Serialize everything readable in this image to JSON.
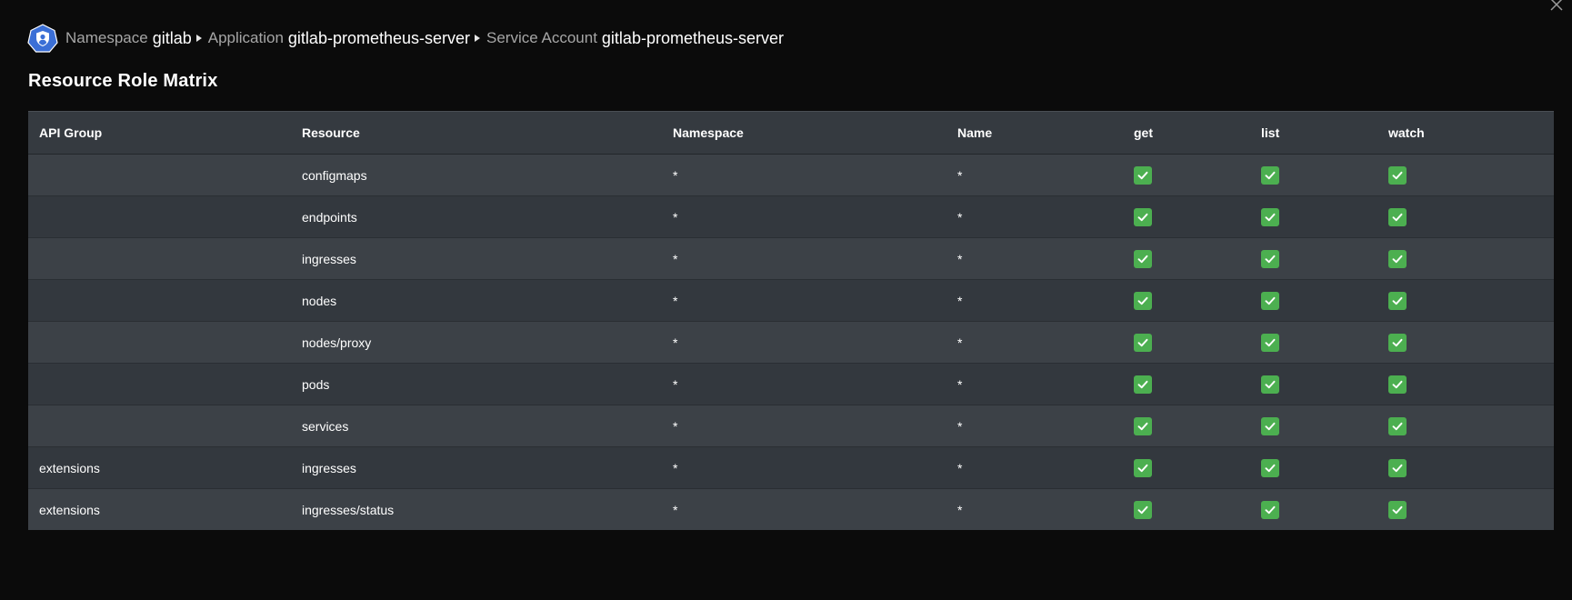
{
  "breadcrumb": {
    "namespace_label": "Namespace",
    "namespace_value": "gitlab",
    "application_label": "Application",
    "application_value": "gitlab-prometheus-server",
    "service_account_label": "Service Account",
    "service_account_value": "gitlab-prometheus-server"
  },
  "page_title": "Resource Role Matrix",
  "table": {
    "headers": {
      "api_group": "API Group",
      "resource": "Resource",
      "namespace": "Namespace",
      "name": "Name",
      "get": "get",
      "list": "list",
      "watch": "watch"
    },
    "rows": [
      {
        "api_group": "",
        "resource": "configmaps",
        "namespace": "*",
        "name": "*",
        "get": true,
        "list": true,
        "watch": true
      },
      {
        "api_group": "",
        "resource": "endpoints",
        "namespace": "*",
        "name": "*",
        "get": true,
        "list": true,
        "watch": true
      },
      {
        "api_group": "",
        "resource": "ingresses",
        "namespace": "*",
        "name": "*",
        "get": true,
        "list": true,
        "watch": true
      },
      {
        "api_group": "",
        "resource": "nodes",
        "namespace": "*",
        "name": "*",
        "get": true,
        "list": true,
        "watch": true
      },
      {
        "api_group": "",
        "resource": "nodes/proxy",
        "namespace": "*",
        "name": "*",
        "get": true,
        "list": true,
        "watch": true
      },
      {
        "api_group": "",
        "resource": "pods",
        "namespace": "*",
        "name": "*",
        "get": true,
        "list": true,
        "watch": true
      },
      {
        "api_group": "",
        "resource": "services",
        "namespace": "*",
        "name": "*",
        "get": true,
        "list": true,
        "watch": true
      },
      {
        "api_group": "extensions",
        "resource": "ingresses",
        "namespace": "*",
        "name": "*",
        "get": true,
        "list": true,
        "watch": true
      },
      {
        "api_group": "extensions",
        "resource": "ingresses/status",
        "namespace": "*",
        "name": "*",
        "get": true,
        "list": true,
        "watch": true
      }
    ]
  },
  "icons": {
    "logo": "kubernetes-shield-icon",
    "close": "close-icon",
    "check": "checkbox-checked-icon",
    "separator": "caret-right-icon"
  },
  "colors": {
    "background": "#0b0b0b",
    "header_row": "#353a40",
    "row_light": "#3c4147",
    "row_dark": "#33383e",
    "check_green": "#4caf50",
    "logo_blue": "#3b6fd6"
  }
}
